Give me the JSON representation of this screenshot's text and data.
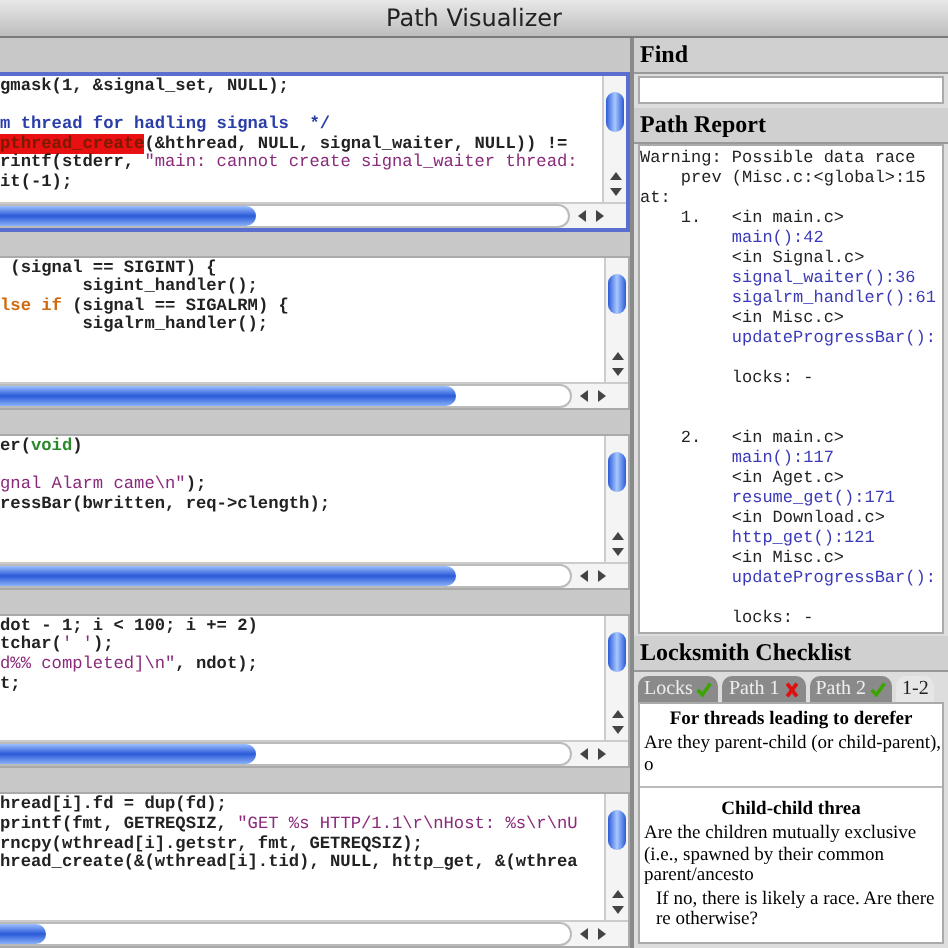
{
  "window": {
    "title": "Path Visualizer"
  },
  "code_panels": [
    {
      "selected": true,
      "lines": [
        {
          "kind": "code",
          "segments": [
            {
              "kind": "plain",
              "text": "gmask(1, &signal_set, NULL);"
            }
          ]
        },
        {
          "kind": "blank"
        },
        {
          "kind": "code",
          "segments": [
            {
              "kind": "comment",
              "text": "m thread for hadling signals  */"
            }
          ]
        },
        {
          "kind": "code",
          "segments": [
            {
              "kind": "highlight",
              "text": "pthread_create"
            },
            {
              "kind": "plain",
              "text": "(&hthread, NULL, signal_waiter, NULL)) !="
            }
          ]
        },
        {
          "kind": "code",
          "segments": [
            {
              "kind": "plain",
              "text": "rintf(stderr, "
            },
            {
              "kind": "string",
              "text": "\"main: cannot create signal_waiter thread:"
            }
          ]
        },
        {
          "kind": "code",
          "segments": [
            {
              "kind": "plain",
              "text": "it(-1);"
            }
          ]
        }
      ]
    },
    {
      "selected": false,
      "lines": [
        {
          "kind": "code",
          "segments": [
            {
              "kind": "plain",
              "text": " (signal == SIGINT) {"
            }
          ]
        },
        {
          "kind": "code",
          "segments": [
            {
              "kind": "plain",
              "text": "        sigint_handler();"
            }
          ]
        },
        {
          "kind": "code",
          "segments": [
            {
              "kind": "keyword",
              "text": "lse if"
            },
            {
              "kind": "plain",
              "text": " (signal == SIGALRM) {"
            }
          ]
        },
        {
          "kind": "code",
          "segments": [
            {
              "kind": "plain",
              "text": "        sigalrm_handler();"
            }
          ]
        }
      ]
    },
    {
      "selected": false,
      "lines": [
        {
          "kind": "code",
          "segments": [
            {
              "kind": "plain",
              "text": "er("
            },
            {
              "kind": "type",
              "text": "void"
            },
            {
              "kind": "plain",
              "text": ")"
            }
          ]
        },
        {
          "kind": "blank"
        },
        {
          "kind": "code",
          "segments": [
            {
              "kind": "string",
              "text": "gnal Alarm came\\n\""
            },
            {
              "kind": "plain",
              "text": ");"
            }
          ]
        },
        {
          "kind": "code",
          "segments": [
            {
              "kind": "plain",
              "text": "ressBar(bwritten, req->clength);"
            }
          ]
        }
      ]
    },
    {
      "selected": false,
      "lines": [
        {
          "kind": "code",
          "segments": [
            {
              "kind": "plain",
              "text": "dot - 1; i < 100; i += 2)"
            }
          ]
        },
        {
          "kind": "code",
          "segments": [
            {
              "kind": "plain",
              "text": "tchar("
            },
            {
              "kind": "string",
              "text": "' '"
            },
            {
              "kind": "plain",
              "text": ");"
            }
          ]
        },
        {
          "kind": "code",
          "segments": [
            {
              "kind": "string",
              "text": "d%% completed]\\n\""
            },
            {
              "kind": "plain",
              "text": ", ndot);"
            }
          ]
        },
        {
          "kind": "code",
          "segments": [
            {
              "kind": "plain",
              "text": "t;"
            }
          ]
        }
      ]
    },
    {
      "selected": false,
      "lines": [
        {
          "kind": "code",
          "segments": [
            {
              "kind": "plain",
              "text": "hread[i].fd = dup(fd);"
            }
          ]
        },
        {
          "kind": "code",
          "segments": [
            {
              "kind": "plain",
              "text": "printf(fmt, GETREQSIZ, "
            },
            {
              "kind": "string",
              "text": "\"GET %s HTTP/1.1\\r\\nHost: %s\\r\\nU"
            }
          ]
        },
        {
          "kind": "code",
          "segments": [
            {
              "kind": "plain",
              "text": "rncpy(wthread[i].getstr, fmt, GETREQSIZ);"
            }
          ]
        },
        {
          "kind": "code",
          "segments": [
            {
              "kind": "plain",
              "text": "hread_create(&(wthread[i].tid), NULL, http_get, &(wthrea"
            }
          ]
        }
      ]
    }
  ],
  "find": {
    "title": "Find"
  },
  "path_report": {
    "title": "Path Report",
    "lines": [
      {
        "kind": "plain",
        "text": "Warning: Possible data race"
      },
      {
        "kind": "plain",
        "text": "    prev (Misc.c:<global>:15"
      },
      {
        "kind": "plain",
        "text": "at:"
      },
      {
        "kind": "plain",
        "text": "    1.   <in main.c>"
      },
      {
        "kind": "link",
        "text": "         main():42"
      },
      {
        "kind": "plain",
        "text": "         <in Signal.c>"
      },
      {
        "kind": "link",
        "text": "         signal_waiter():36"
      },
      {
        "kind": "link",
        "text": "         sigalrm_handler():61"
      },
      {
        "kind": "plain",
        "text": "         <in Misc.c>"
      },
      {
        "kind": "link",
        "text": "         updateProgressBar():"
      },
      {
        "kind": "blank"
      },
      {
        "kind": "plain",
        "text": "         locks: -"
      },
      {
        "kind": "blank"
      },
      {
        "kind": "blank"
      },
      {
        "kind": "plain",
        "text": "    2.   <in main.c>"
      },
      {
        "kind": "link",
        "text": "         main():117"
      },
      {
        "kind": "plain",
        "text": "         <in Aget.c>"
      },
      {
        "kind": "link",
        "text": "         resume_get():171"
      },
      {
        "kind": "plain",
        "text": "         <in Download.c>"
      },
      {
        "kind": "link",
        "text": "         http_get():121"
      },
      {
        "kind": "plain",
        "text": "         <in Misc.c>"
      },
      {
        "kind": "link",
        "text": "         updateProgressBar():"
      },
      {
        "kind": "blank"
      },
      {
        "kind": "plain",
        "text": "         locks: -"
      }
    ]
  },
  "checklist": {
    "title": "Locksmith Checklist",
    "tabs": [
      {
        "label": "Locks",
        "kind": "passed",
        "selected": false
      },
      {
        "label": "Path 1",
        "kind": "failed",
        "selected": false
      },
      {
        "label": "Path 2",
        "kind": "passed",
        "selected": false
      },
      {
        "label": "1-2",
        "kind": "plain",
        "selected": true
      }
    ],
    "blocks": [
      {
        "kind": "heading",
        "text": "For threads leading to derefer"
      },
      {
        "kind": "text",
        "text": "Are they parent-child (or child-parent), o"
      },
      {
        "kind": "rule"
      },
      {
        "kind": "heading",
        "text": "Child-child threa"
      },
      {
        "kind": "text",
        "text": "Are the children mutually exclusive (i.e., spawned by their common parent/ancesto"
      },
      {
        "kind": "indent",
        "text": "If no, there is likely a race. Are there re otherwise?"
      }
    ]
  }
}
